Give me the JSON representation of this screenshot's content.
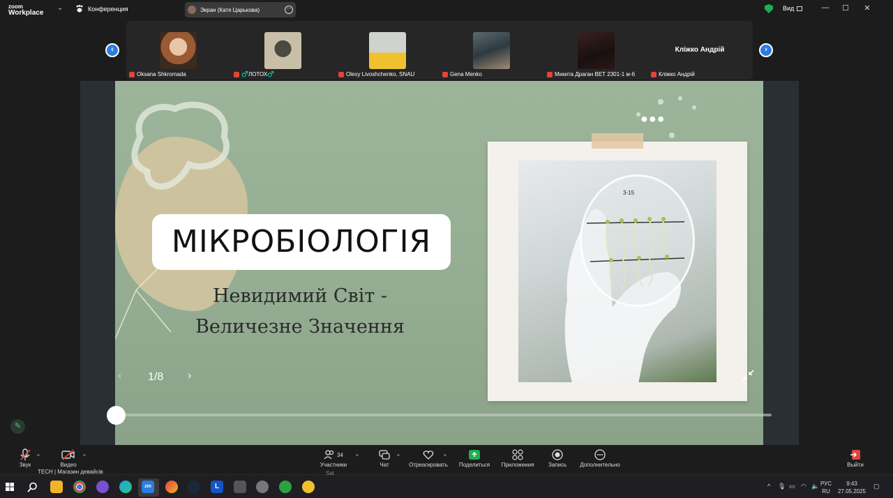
{
  "app": {
    "logo_top": "zoom",
    "logo_bottom": "Workplace",
    "conference_label": "Конференция",
    "screen_share_label": "Экран (Катя Царькова)",
    "view_label": "Вид"
  },
  "participants": [
    {
      "name": "Oksana Shkromada",
      "muted": true
    },
    {
      "name": "♂️ЛОТОХ♂️",
      "muted": true
    },
    {
      "name": "Olexy Livoshchenko, SNAU",
      "muted": true
    },
    {
      "name": "Gena Menko",
      "muted": true
    },
    {
      "name": "Микита Драган ВЕТ 2301-1 м-6",
      "muted": true
    },
    {
      "name": "Кліжко Андрій",
      "display_name": "Кліжко Андрій",
      "muted": true
    }
  ],
  "slide": {
    "title": "МІКРОБІОЛОГІЯ",
    "subtitle_line1": "Невидимий Світ -",
    "subtitle_line2": "Величезне Значення",
    "page_indicator": "1/8",
    "dish_label": "3-15"
  },
  "toolbar": {
    "audio": "Звук",
    "video": "Видео",
    "participants": "Участники",
    "participants_count": "34",
    "chat": "Чат",
    "react": "Отреагировать",
    "share": "Поделиться",
    "apps": "Приложения",
    "record": "Запись",
    "more": "Дополнительно",
    "leave": "Выйти"
  },
  "taskbar": {
    "notification_text": "TECH | Магазин девайсів",
    "notification_sub": "Sat",
    "lang_top": "РУС",
    "lang_bottom": "RU",
    "time": "9:43",
    "date": "27.05.2025"
  },
  "colors": {
    "accent_blue": "#2d7de0",
    "share_green": "#1fae4f",
    "mute_red": "#e0443c",
    "slide_green": "#9cb59a"
  }
}
